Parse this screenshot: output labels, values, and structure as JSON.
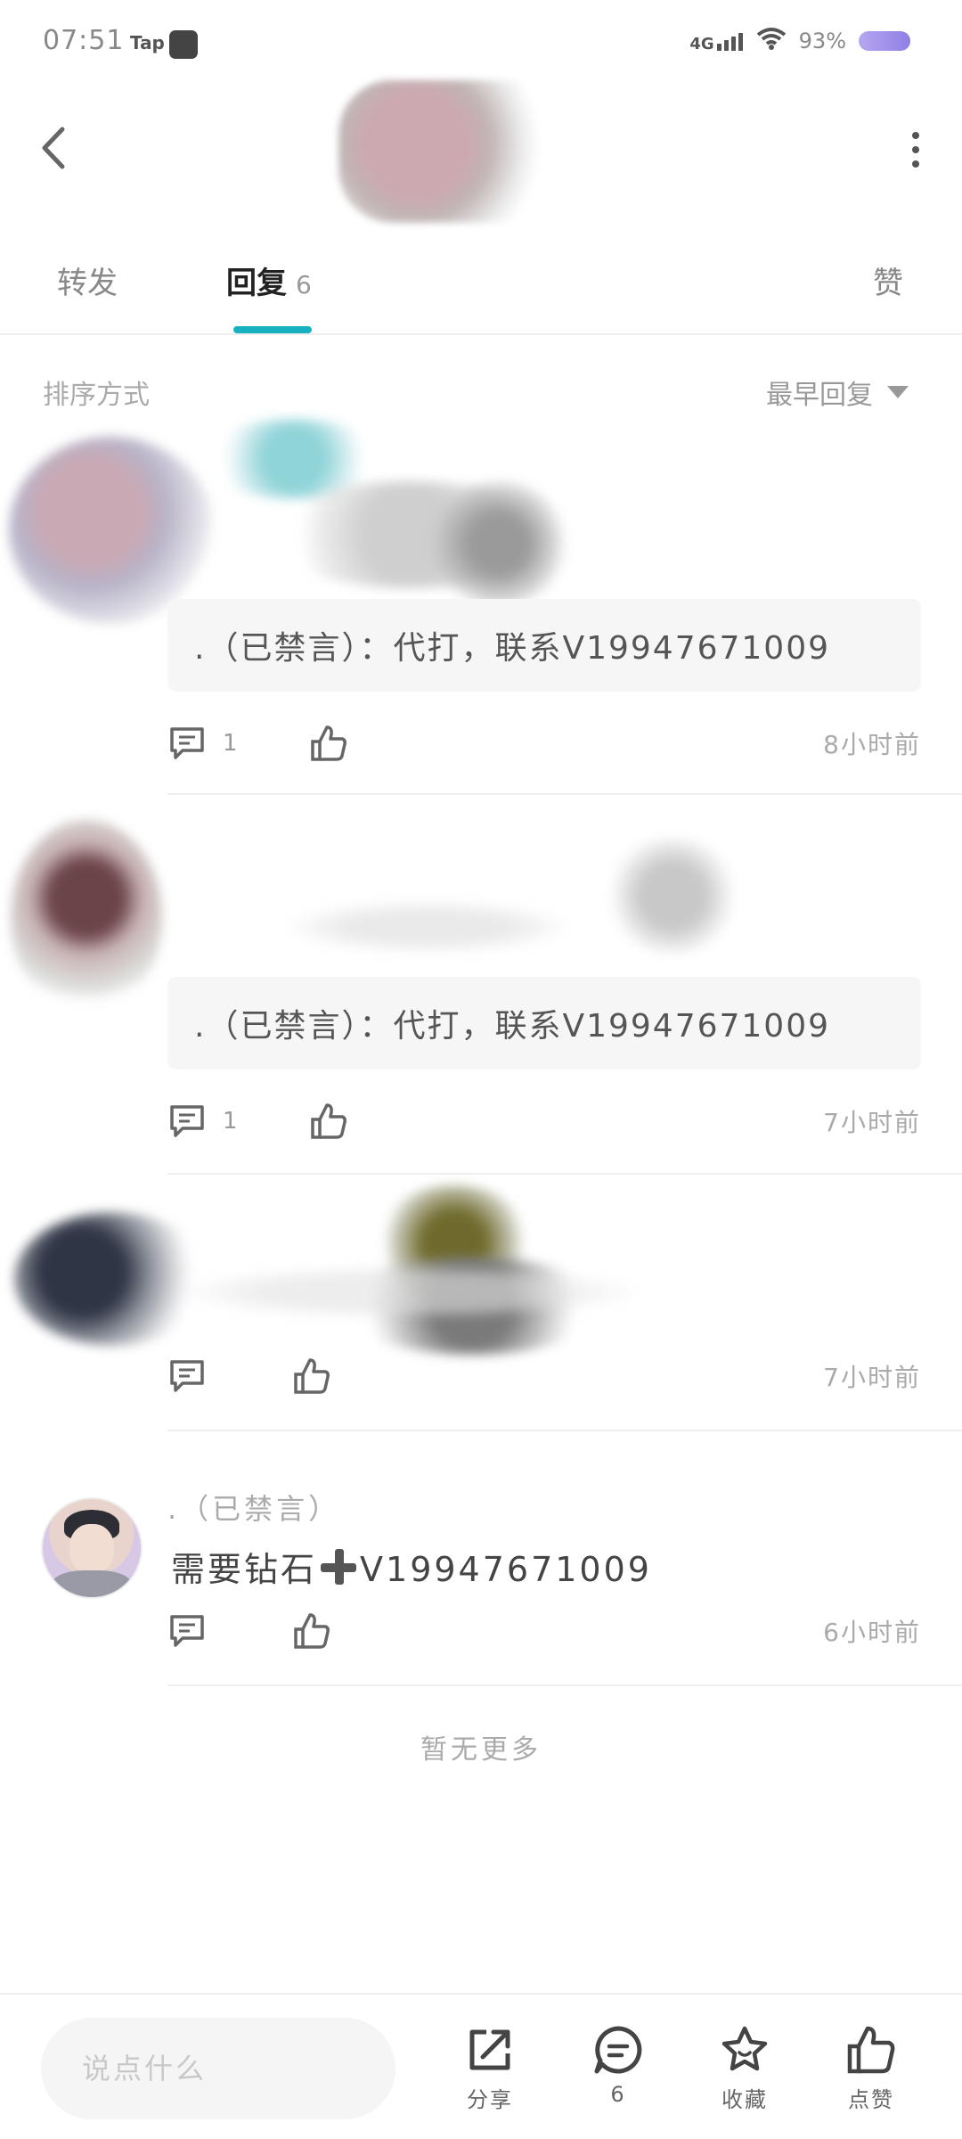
{
  "status_bar": {
    "time": "07:51",
    "tap_label": "Tap",
    "network": "4G",
    "battery": "93%"
  },
  "tabs": {
    "repost_label": "转发",
    "reply_label": "回复",
    "reply_count": "6",
    "like_label": "赞"
  },
  "sort": {
    "label": "排序方式",
    "value": "最早回复"
  },
  "comments": [
    {
      "quote": ".（已禁言）：代打，联系V19947671009",
      "reply_count": "1",
      "time": "8小时前"
    },
    {
      "quote": ".（已禁言）：代打，联系V19947671009",
      "reply_count": "1",
      "time": "7小时前"
    },
    {
      "time": "7小时前"
    },
    {
      "author": ".（已禁言）",
      "text_before": "需要钻石",
      "text_after": "V19947671009",
      "time": "6小时前"
    }
  ],
  "footer_text": "暂无更多",
  "bottom_bar": {
    "input_placeholder": "说点什么",
    "share_label": "分享",
    "comment_count": "6",
    "collect_label": "收藏",
    "like_label": "点赞"
  },
  "colors": {
    "accent": "#17b1bf"
  },
  "icons": [
    "back-icon",
    "more-vertical-icon",
    "comment-icon",
    "thumbs-up-icon",
    "share-icon",
    "star-icon",
    "dropdown-triangle-icon"
  ]
}
